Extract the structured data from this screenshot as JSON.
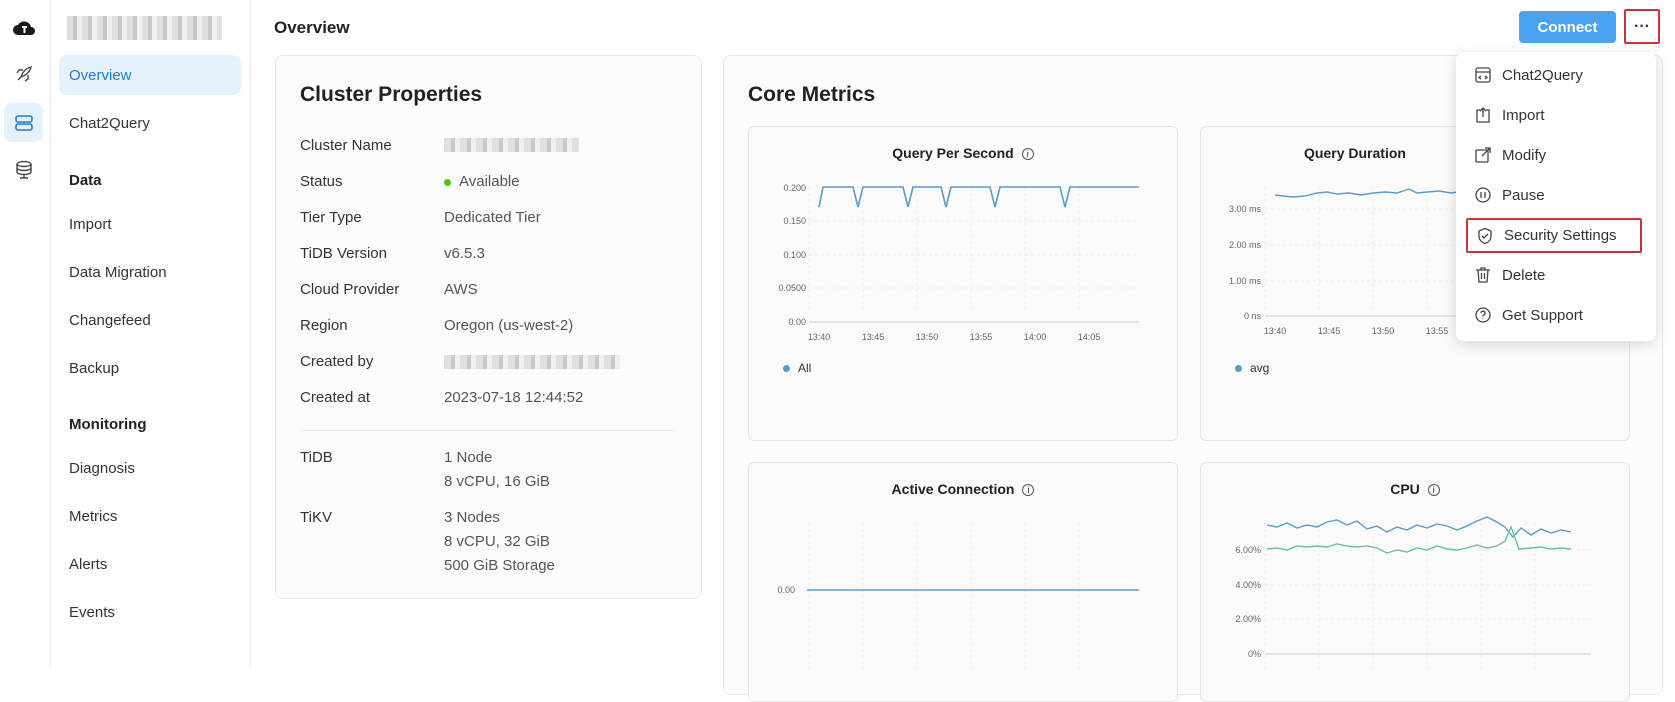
{
  "sidebar": {
    "nav": [
      {
        "label": "Overview"
      },
      {
        "label": "Chat2Query"
      },
      {
        "label": "Import"
      },
      {
        "label": "Data Migration"
      },
      {
        "label": "Changefeed"
      },
      {
        "label": "Backup"
      },
      {
        "label": "Diagnosis"
      },
      {
        "label": "Metrics"
      },
      {
        "label": "Alerts"
      },
      {
        "label": "Events"
      }
    ],
    "groups": {
      "data": "Data",
      "monitoring": "Monitoring"
    }
  },
  "header": {
    "title": "Overview",
    "connect_label": "Connect",
    "more_label": "···"
  },
  "properties": {
    "title": "Cluster Properties",
    "rows": [
      {
        "label": "Cluster Name"
      },
      {
        "label": "Status",
        "value": "Available"
      },
      {
        "label": "Tier Type",
        "value": "Dedicated Tier"
      },
      {
        "label": "TiDB Version",
        "value": "v6.5.3"
      },
      {
        "label": "Cloud Provider",
        "value": "AWS"
      },
      {
        "label": "Region",
        "value": "Oregon (us-west-2)"
      },
      {
        "label": "Created by"
      },
      {
        "label": "Created at",
        "value": "2023-07-18 12:44:52"
      }
    ],
    "nodes": [
      {
        "label": "TiDB",
        "lines": [
          "1 Node",
          "8 vCPU, 16 GiB"
        ]
      },
      {
        "label": "TiKV",
        "lines": [
          "3 Nodes",
          "8 vCPU, 32 GiB",
          "500 GiB Storage"
        ]
      }
    ],
    "status_color": "#52c41a"
  },
  "metrics": {
    "title": "Core Metrics",
    "qps": {
      "title": "Query Per Second",
      "legend": "All",
      "y_ticks": [
        "0.200",
        "0.150",
        "0.100",
        "0.0500",
        "0.00"
      ],
      "x_ticks": [
        "13:40",
        "13:45",
        "13:50",
        "13:55",
        "14:00",
        "14:05"
      ]
    },
    "duration": {
      "title": "Query Duration",
      "legend": "avg",
      "y_ticks": [
        "3.00 ms",
        "2.00 ms",
        "1.00 ms",
        "0 ns"
      ],
      "x_ticks": [
        "13:40",
        "13:45",
        "13:50",
        "13:55"
      ]
    },
    "connection": {
      "title": "Active Connection",
      "y_ticks": [
        "0.00"
      ]
    },
    "cpu": {
      "title": "CPU",
      "y_ticks": [
        "6.00%",
        "4.00%",
        "2.00%",
        "0%"
      ]
    },
    "colors": {
      "series1": "#5b9bc8",
      "series2": "#6cc0a0"
    }
  },
  "menu": {
    "items": [
      {
        "label": "Chat2Query",
        "icon": "chat2query-icon"
      },
      {
        "label": "Import",
        "icon": "import-icon"
      },
      {
        "label": "Modify",
        "icon": "modify-icon"
      },
      {
        "label": "Pause",
        "icon": "pause-icon"
      },
      {
        "label": "Security Settings",
        "icon": "shield-icon"
      },
      {
        "label": "Delete",
        "icon": "trash-icon"
      },
      {
        "label": "Get Support",
        "icon": "help-icon"
      }
    ]
  }
}
